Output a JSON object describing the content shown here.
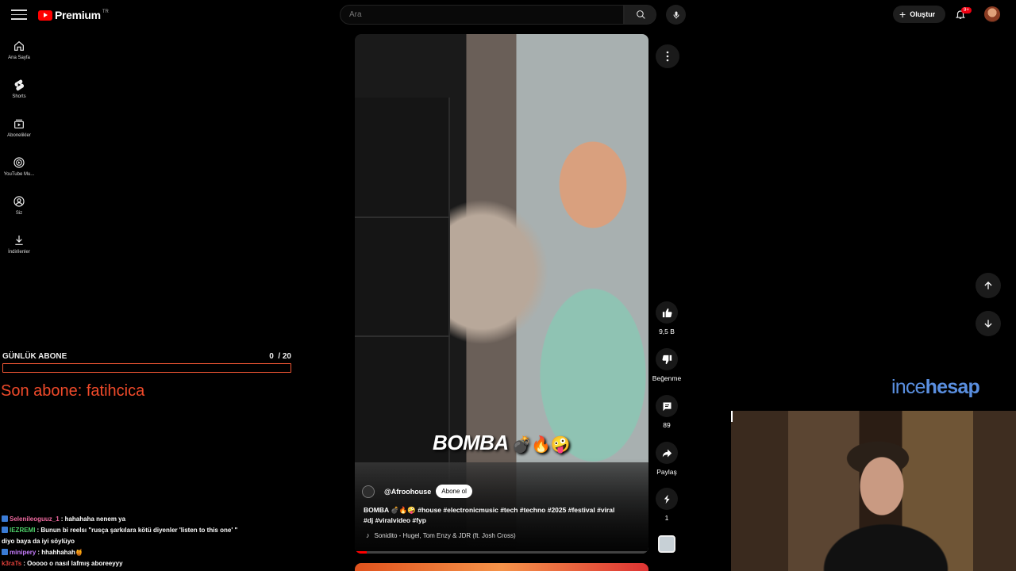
{
  "topbar": {
    "brand": "Premium",
    "country_code": "TR",
    "search_placeholder": "Ara",
    "create_label": "Oluştur",
    "notification_count": "9+"
  },
  "sidebar": {
    "items": [
      {
        "label": "Ana Sayfa",
        "icon": "home-icon"
      },
      {
        "label": "Shorts",
        "icon": "shorts-icon"
      },
      {
        "label": "Abonelikler",
        "icon": "subscriptions-icon"
      },
      {
        "label": "YouTube Mu...",
        "icon": "youtube-music-icon"
      },
      {
        "label": "Siz",
        "icon": "user-icon"
      },
      {
        "label": "İndirilenler",
        "icon": "download-icon"
      }
    ]
  },
  "overlay": {
    "goal_title": "GÜNLÜK ABONE",
    "goal_count": "0",
    "goal_total": "/ 20",
    "goal_progress": 0,
    "last_sub": "Son abone: fatihcica",
    "accent": "#f04a2a"
  },
  "chat": [
    {
      "user": "Selenileoguuz_1",
      "user_color": "#f06aa0",
      "msg": ": hahahaha nenem ya"
    },
    {
      "user": "IEZREMI",
      "user_color": "#4fd36b",
      "msg": ": Bunun bi reelsı \"rusça şarkılara kötü diyenler 'listen to this one' \""
    },
    {
      "user": "",
      "user_color": "#ffffff",
      "msg": "diyo baya da iyi söylüyo"
    },
    {
      "user": "minipery",
      "user_color": "#c77dff",
      "msg": ": hhahhahah🍯"
    },
    {
      "user": "k3raTs",
      "user_color": "#e0413a",
      "msg": ": Ooooo o nasıl lafmış aboreeyyy"
    }
  ],
  "video": {
    "caption": "BOMBA",
    "caption_emoji": "💣🔥🤪",
    "channel": "@Afroohouse",
    "subscribe_label": "Abone ol",
    "description": "BOMBA 💣🔥🤪 #house #electronicmusic #tech #techno #2025 #festival #viral #dj #viralvideo #fyp",
    "song": "Sonidito - Hugel, Tom Enzy & JDR (ft. Josh Cross)",
    "progress": 0.04
  },
  "actions": {
    "like_count": "9,5 B",
    "dislike_label": "Beğenme",
    "comment_count": "89",
    "share_label": "Paylaş",
    "remix_count": "1"
  },
  "webcam": {
    "brand_light": "ince",
    "brand_bold": "hesap"
  }
}
